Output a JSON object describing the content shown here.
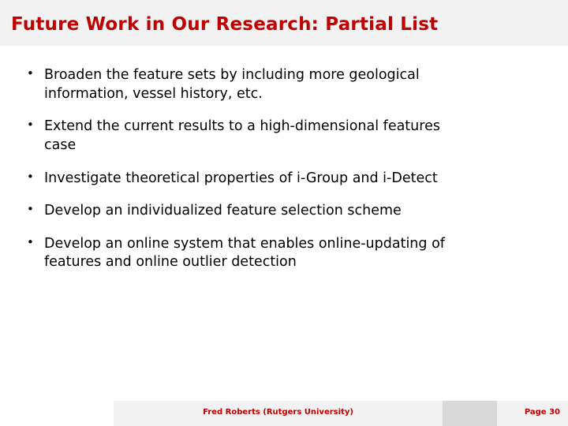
{
  "slide": {
    "title": "Future Work in Our Research: Partial List",
    "title_color": "#c00000",
    "bullets": [
      {
        "line1": "Broaden  the  feature  sets  by  including  more  geological",
        "line2": "information,  vessel  history,  etc."
      },
      {
        "line1": "Extend  the  current  results  to  a  high-dimensional  features",
        "line2": "case"
      },
      {
        "line1": "Investigate  theoretical  properties  of  i-Group  and  i-Detect",
        "line2": ""
      },
      {
        "line1": "Develop  an  individualized  feature  selection  scheme",
        "line2": ""
      },
      {
        "line1": "Develop  an  online  system  that  enables  online-updating  of",
        "line2": "features  and  online  outlier  detection"
      }
    ],
    "footer": {
      "center_text": "Fred Roberts (Rutgers University)",
      "page_label": "Page  30"
    }
  }
}
